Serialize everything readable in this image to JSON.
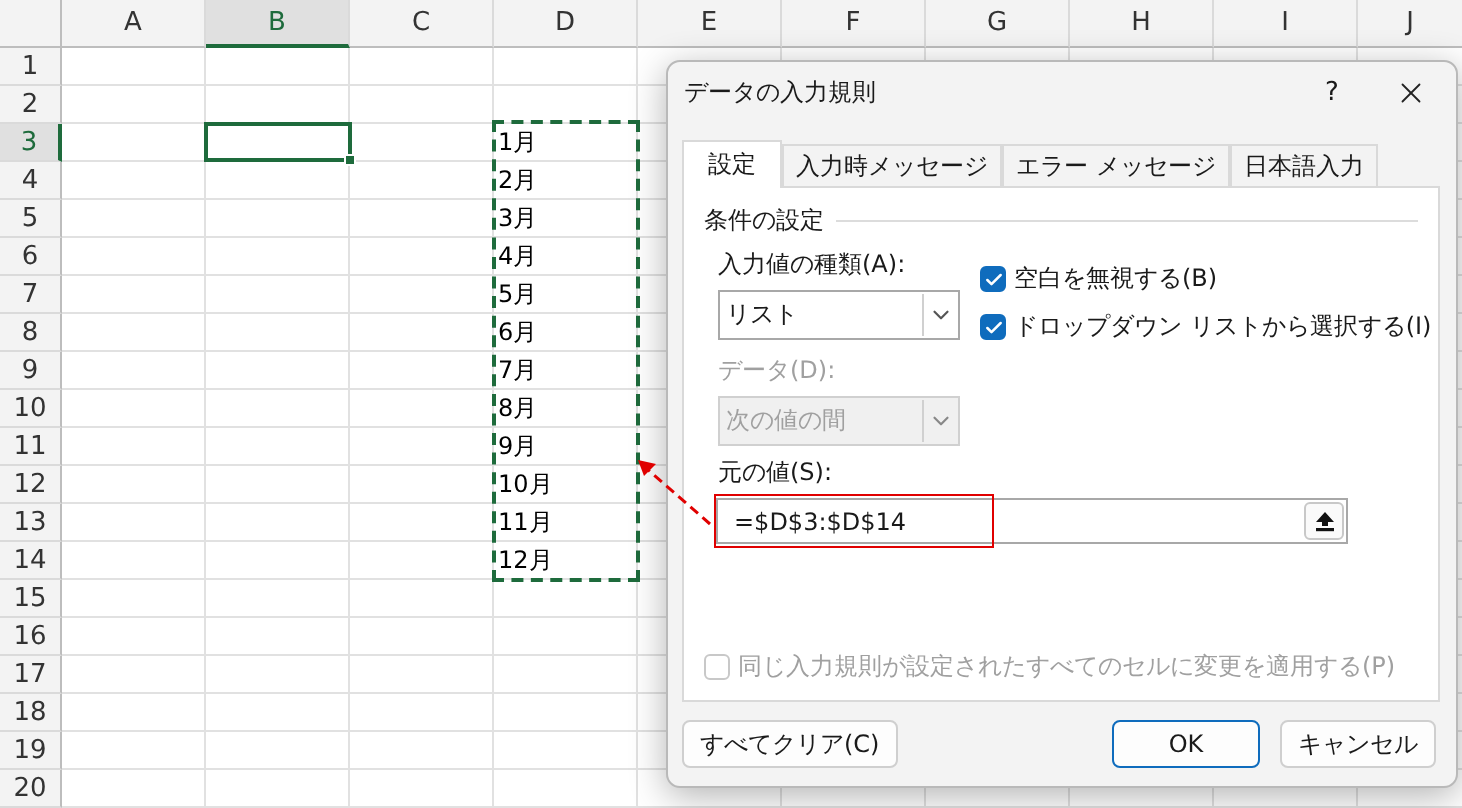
{
  "sheet": {
    "columns": [
      {
        "label": "A",
        "selected": false
      },
      {
        "label": "B",
        "selected": true
      },
      {
        "label": "C",
        "selected": false
      },
      {
        "label": "D",
        "selected": false
      },
      {
        "label": "E",
        "selected": false
      },
      {
        "label": "F",
        "selected": false
      },
      {
        "label": "G",
        "selected": false
      },
      {
        "label": "H",
        "selected": false
      },
      {
        "label": "I",
        "selected": false
      },
      {
        "label": "J",
        "selected": false
      }
    ],
    "rows": [
      {
        "label": "1",
        "selected": false
      },
      {
        "label": "2",
        "selected": false
      },
      {
        "label": "3",
        "selected": true,
        "column_d": "1月"
      },
      {
        "label": "4",
        "selected": false,
        "column_d": "2月"
      },
      {
        "label": "5",
        "selected": false,
        "column_d": "3月"
      },
      {
        "label": "6",
        "selected": false,
        "column_d": "4月"
      },
      {
        "label": "7",
        "selected": false,
        "column_d": "5月"
      },
      {
        "label": "8",
        "selected": false,
        "column_d": "6月"
      },
      {
        "label": "9",
        "selected": false,
        "column_d": "7月"
      },
      {
        "label": "10",
        "selected": false,
        "column_d": "8月"
      },
      {
        "label": "11",
        "selected": false,
        "column_d": "9月"
      },
      {
        "label": "12",
        "selected": false,
        "column_d": "10月"
      },
      {
        "label": "13",
        "selected": false,
        "column_d": "11月"
      },
      {
        "label": "14",
        "selected": false,
        "column_d": "12月"
      },
      {
        "label": "15",
        "selected": false
      },
      {
        "label": "16",
        "selected": false
      },
      {
        "label": "17",
        "selected": false
      },
      {
        "label": "18",
        "selected": false
      },
      {
        "label": "19",
        "selected": false
      },
      {
        "label": "20",
        "selected": false
      }
    ]
  },
  "dialog": {
    "title": "データの入力規則",
    "help": "?",
    "tabs": [
      {
        "label": "設定",
        "selected": true
      },
      {
        "label": "入力時メッセージ",
        "selected": false
      },
      {
        "label": "エラー メッセージ",
        "selected": false
      },
      {
        "label": "日本語入力",
        "selected": false
      }
    ],
    "group_title": "条件の設定",
    "allow": {
      "label": "入力値の種類(A):",
      "value": "リスト",
      "disabled": false
    },
    "options": [
      {
        "label": "空白を無視する(B)",
        "checked": true
      },
      {
        "label": "ドロップダウン リストから選択する(I)",
        "checked": true
      }
    ],
    "data": {
      "label": "データ(D):",
      "value": "次の値の間",
      "disabled": true
    },
    "source": {
      "label": "元の値(S):",
      "value": "=$D$3:$D$14"
    },
    "apply_all": {
      "label": "同じ入力規則が設定されたすべてのセルに変更を適用する(P)",
      "checked": false,
      "disabled": true
    },
    "buttons": [
      {
        "label": "すべてクリア(C)",
        "kind": "left"
      },
      {
        "label": "OK",
        "kind": "default"
      },
      {
        "label": "キャンセル",
        "kind": "normal"
      }
    ]
  }
}
